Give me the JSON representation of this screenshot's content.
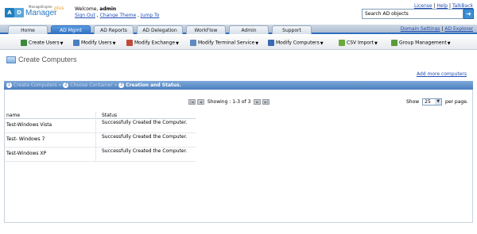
{
  "header": {
    "brand_top": "ManageEngine",
    "brand_box1": "A",
    "brand_box2": "D",
    "brand_name": "Manager",
    "brand_plus": "plus",
    "welcome_prefix": "Welcome,",
    "username": "admin",
    "links": [
      "Sign Out",
      "Change Theme",
      "Jump To"
    ],
    "right_links": [
      "License",
      "Help",
      "TalkBack"
    ],
    "search_value": "Search AD objects",
    "search_button_icon": "arrow-right-icon"
  },
  "tabs": [
    {
      "label": "Home",
      "active": false
    },
    {
      "label": "AD Mgmt",
      "active": true
    },
    {
      "label": "AD Reports",
      "active": false
    },
    {
      "label": "AD Delegation",
      "active": false
    },
    {
      "label": "WorkFlow",
      "active": false
    },
    {
      "label": "Admin",
      "active": false
    },
    {
      "label": "Support",
      "active": false
    }
  ],
  "tab_right_links": [
    "Domain Settings",
    "AD Explorer"
  ],
  "submenu": [
    {
      "label": "Create Users",
      "icon": "add-user-icon",
      "color": "#3a8a3a"
    },
    {
      "label": "Modify Users",
      "icon": "modify-user-icon",
      "color": "#4a7fc0"
    },
    {
      "label": "Modify Exchange",
      "icon": "exchange-icon",
      "color": "#c04a3a"
    },
    {
      "label": "Modify Terminal Service",
      "icon": "terminal-icon",
      "color": "#5a8ac0"
    },
    {
      "label": "Modify Computers",
      "icon": "computer-icon",
      "color": "#3a6ab0"
    },
    {
      "label": "CSV Import",
      "icon": "csv-icon",
      "color": "#6aaa3a"
    },
    {
      "label": "Group Management",
      "icon": "group-icon",
      "color": "#5a9a3a"
    }
  ],
  "page": {
    "title": "Create Computers",
    "add_more": "Add more computers"
  },
  "wizard": [
    {
      "num": "1",
      "label": "Create Computers",
      "current": false
    },
    {
      "num": "2",
      "label": "Choose Container",
      "current": false
    },
    {
      "num": "3",
      "label": "Creation and Status.",
      "current": true
    }
  ],
  "pager": {
    "text": "Showing : 1-3 of 3",
    "show_label": "Show",
    "per_page": "25",
    "per_page_suffix": "per page."
  },
  "table": {
    "columns": [
      "name",
      "Status"
    ],
    "rows": [
      [
        "Test-Windows Vista",
        "Successfully Created the Computer."
      ],
      [
        "Test- Windows 7",
        "Successfully Created the Computer."
      ],
      [
        "Test-Windows XP",
        "Successfully Created the Computer."
      ]
    ]
  },
  "colors": {
    "accent": "#2f6fc0",
    "link": "#1f4db5"
  }
}
